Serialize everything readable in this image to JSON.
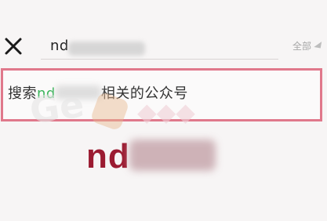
{
  "search": {
    "query_visible": "nd",
    "scope_label": "全部"
  },
  "suggestion": {
    "prefix": "搜索",
    "keyword_visible": "nd",
    "suffix": "相关的公众号"
  },
  "result": {
    "title_visible": "nd"
  },
  "watermark": {
    "text": "Ge"
  },
  "icons": {
    "close": "close-icon",
    "scope_dropdown": "chevron-down-icon"
  },
  "colors": {
    "accent_green": "#3bb55b",
    "highlight_border": "#e0788b",
    "result_text": "#9b1b31"
  }
}
